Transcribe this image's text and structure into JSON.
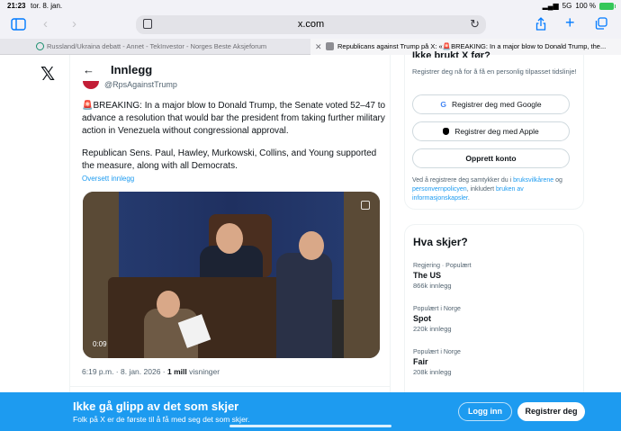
{
  "statusbar": {
    "time": "21:23",
    "date": "tor. 8. jan.",
    "network": "5G",
    "battery": "100 %"
  },
  "browser": {
    "url": "x.com",
    "tabs": [
      {
        "label": "Russland/Ukraina debatt - Annet - TekInvestor - Norges Beste Aksjeforum"
      },
      {
        "label": "Republicans against Trump på X: «🚨BREAKING: In a major blow to Donald Trump, the..."
      }
    ]
  },
  "header": {
    "title": "Innlegg"
  },
  "post": {
    "handle": "@RpsAgainstTrump",
    "paragraph1": "🚨BREAKING: In a major blow to Donald Trump, the Senate voted 52–47 to advance a resolution that would bar the president from taking further military action in Venezuela without congressional approval.",
    "paragraph2": "Republican Sens. Paul, Hawley, Murkowski, Collins, and Young supported the measure, along with all Democrats.",
    "translate": "Oversett innlegg",
    "video_time": "0:09",
    "timestamp": "6:19 p.m. · 8. jan. 2026 · ",
    "views_count": "1 mill",
    "views_label": " visninger"
  },
  "signup": {
    "title": "Ikke brukt X før?",
    "subtitle": "Registrer deg nå for å få en personlig tilpasset tidslinje!",
    "google_label": "Registrer deg med Google",
    "apple_label": "Registrer deg med Apple",
    "create_label": "Opprett konto",
    "legal_pre": "Ved å registrere deg samtykker du i ",
    "terms": "bruksvilkårene",
    "legal_mid1": " og ",
    "privacy": "personvernpolicyen",
    "legal_mid2": ", inkludert ",
    "cookies": "bruken av informasjonskapsler",
    "legal_end": "."
  },
  "trends": {
    "title": "Hva skjer?",
    "items": [
      {
        "context": "Regjering · Populært",
        "topic": "The US",
        "count": "866k innlegg"
      },
      {
        "context": "Populært i Norge",
        "topic": "Spot",
        "count": "220k innlegg"
      },
      {
        "context": "Populært i Norge",
        "topic": "Fair",
        "count": "208k innlegg"
      }
    ]
  },
  "banner": {
    "title": "Ikke gå glipp av det som skjer",
    "subtitle": "Folk på X er de første til å få med seg det som skjer.",
    "login": "Logg inn",
    "register": "Registrer deg"
  },
  "colors": {
    "accent": "#1d9bf0",
    "ios_blue": "#007aff"
  }
}
